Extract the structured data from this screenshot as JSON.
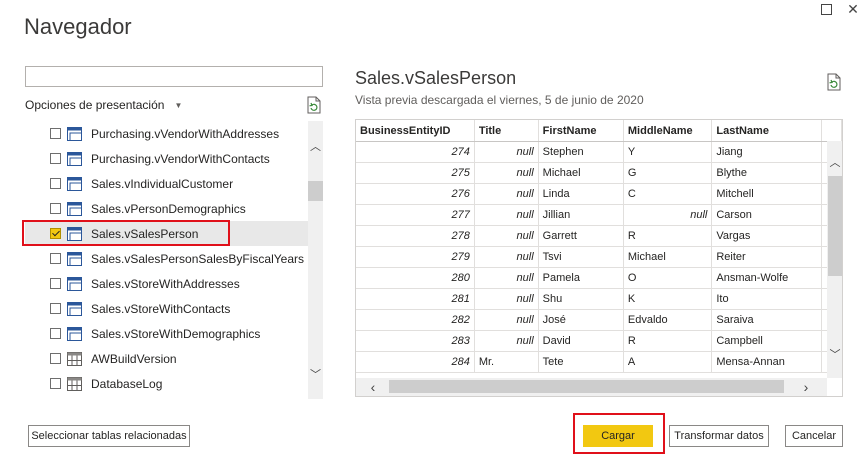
{
  "window": {
    "title": "Navegador",
    "maximize_icon": "maximize-icon",
    "close_icon": "close-icon",
    "close_glyph": "✕"
  },
  "left": {
    "search_value": "",
    "options_label": "Opciones de presentación",
    "items": [
      {
        "label": "Purchasing.vVendorWithAddresses",
        "checked": false,
        "icon": "view-icon"
      },
      {
        "label": "Purchasing.vVendorWithContacts",
        "checked": false,
        "icon": "view-icon"
      },
      {
        "label": "Sales.vIndividualCustomer",
        "checked": false,
        "icon": "view-icon"
      },
      {
        "label": "Sales.vPersonDemographics",
        "checked": false,
        "icon": "view-icon"
      },
      {
        "label": "Sales.vSalesPerson",
        "checked": true,
        "icon": "view-icon"
      },
      {
        "label": "Sales.vSalesPersonSalesByFiscalYears",
        "checked": false,
        "icon": "view-icon"
      },
      {
        "label": "Sales.vStoreWithAddresses",
        "checked": false,
        "icon": "view-icon"
      },
      {
        "label": "Sales.vStoreWithContacts",
        "checked": false,
        "icon": "view-icon"
      },
      {
        "label": "Sales.vStoreWithDemographics",
        "checked": false,
        "icon": "view-icon"
      },
      {
        "label": "AWBuildVersion",
        "checked": false,
        "icon": "table-icon"
      },
      {
        "label": "DatabaseLog",
        "checked": false,
        "icon": "table-icon"
      }
    ],
    "up_glyph": "︿",
    "down_glyph": "﹀"
  },
  "preview": {
    "title": "Sales.vSalesPerson",
    "subtitle": "Vista previa descargada el viernes, 5 de junio de 2020",
    "columns": [
      "BusinessEntityID",
      "Title",
      "FirstName",
      "MiddleName",
      "LastName",
      ""
    ],
    "rows": [
      [
        "274",
        "null",
        "Stephen",
        "Y",
        "Jiang"
      ],
      [
        "275",
        "null",
        "Michael",
        "G",
        "Blythe"
      ],
      [
        "276",
        "null",
        "Linda",
        "C",
        "Mitchell"
      ],
      [
        "277",
        "null",
        "Jillian",
        "null",
        "Carson"
      ],
      [
        "278",
        "null",
        "Garrett",
        "R",
        "Vargas"
      ],
      [
        "279",
        "null",
        "Tsvi",
        "Michael",
        "Reiter"
      ],
      [
        "280",
        "null",
        "Pamela",
        "O",
        "Ansman-Wolfe"
      ],
      [
        "281",
        "null",
        "Shu",
        "K",
        "Ito"
      ],
      [
        "282",
        "null",
        "José",
        "Edvaldo",
        "Saraiva"
      ],
      [
        "283",
        "null",
        "David",
        "R",
        "Campbell"
      ],
      [
        "284",
        "Mr.",
        "Tete",
        "A",
        "Mensa-Annan"
      ]
    ],
    "left_glyph": "‹",
    "right_glyph": "›"
  },
  "buttons": {
    "select_related": "Seleccionar tablas relacionadas",
    "load": "Cargar",
    "transform": "Transformar datos",
    "cancel": "Cancelar"
  },
  "colors": {
    "accent": "#f2c811",
    "highlight_border": "#e0101a"
  }
}
